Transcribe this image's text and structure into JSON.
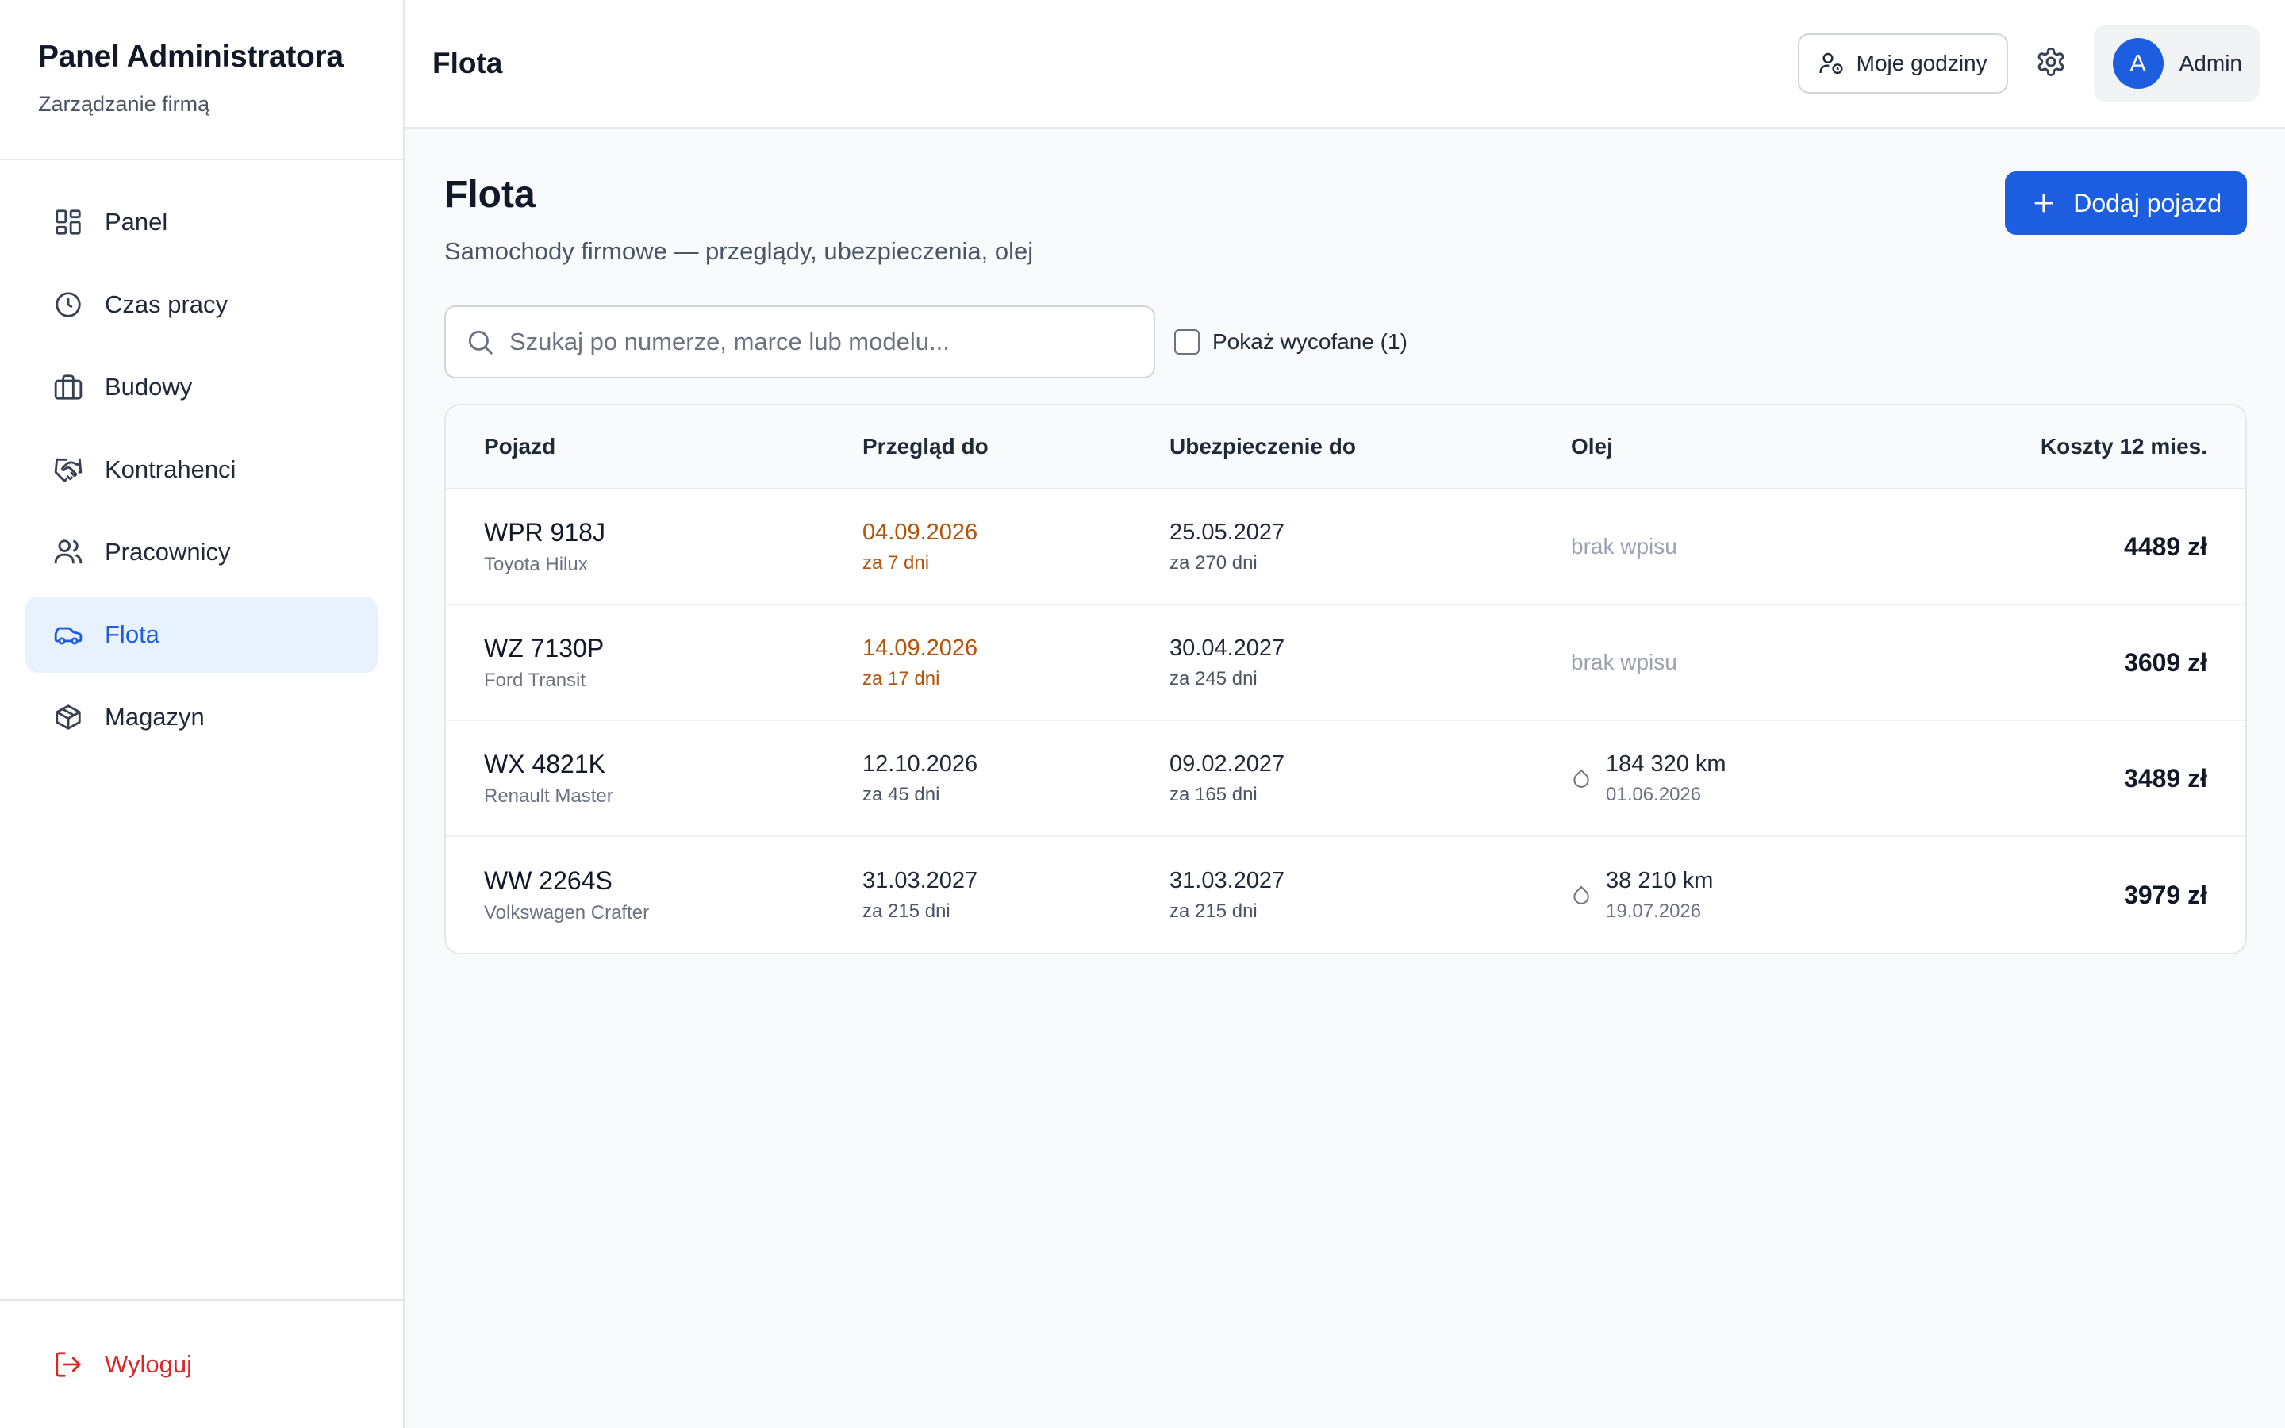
{
  "sidebar": {
    "title": "Panel Administratora",
    "subtitle": "Zarządzanie firmą",
    "items": [
      {
        "label": "Panel",
        "icon": "dashboard-icon"
      },
      {
        "label": "Czas pracy",
        "icon": "clock-icon"
      },
      {
        "label": "Budowy",
        "icon": "briefcase-icon"
      },
      {
        "label": "Kontrahenci",
        "icon": "handshake-icon"
      },
      {
        "label": "Pracownicy",
        "icon": "users-icon"
      },
      {
        "label": "Flota",
        "icon": "car-icon",
        "active": true
      },
      {
        "label": "Magazyn",
        "icon": "package-icon"
      }
    ],
    "logout": "Wyloguj"
  },
  "topbar": {
    "title": "Flota",
    "hours_button": "Moje godziny",
    "user_initial": "A",
    "user_name": "Admin"
  },
  "page": {
    "title": "Flota",
    "subtitle": "Samochody firmowe — przeglądy, ubezpieczenia, olej",
    "add_button": "Dodaj pojazd",
    "search_placeholder": "Szukaj po numerze, marce lub modelu...",
    "show_retired_label": "Pokaż wycofane (1)"
  },
  "table": {
    "headers": [
      "Pojazd",
      "Przegląd do",
      "Ubezpieczenie do",
      "Olej",
      "Koszty 12 mies."
    ],
    "rows": [
      {
        "plate": "WPR 918J",
        "model": "Toyota Hilux",
        "inspection": "04.09.2026",
        "inspection_rel": "za 7 dni",
        "inspection_warn": true,
        "insurance": "25.05.2027",
        "insurance_rel": "za 270 dni",
        "oil_none": "brak wpisu",
        "cost": "4489 zł"
      },
      {
        "plate": "WZ 7130P",
        "model": "Ford Transit",
        "inspection": "14.09.2026",
        "inspection_rel": "za 17 dni",
        "inspection_warn": true,
        "insurance": "30.04.2027",
        "insurance_rel": "za 245 dni",
        "oil_none": "brak wpisu",
        "cost": "3609 zł"
      },
      {
        "plate": "WX 4821K",
        "model": "Renault Master",
        "inspection": "12.10.2026",
        "inspection_rel": "za 45 dni",
        "inspection_warn": false,
        "insurance": "09.02.2027",
        "insurance_rel": "za 165 dni",
        "oil_km": "184 320 km",
        "oil_date": "01.06.2026",
        "cost": "3489 zł"
      },
      {
        "plate": "WW 2264S",
        "model": "Volkswagen Crafter",
        "inspection": "31.03.2027",
        "inspection_rel": "za 215 dni",
        "inspection_warn": false,
        "insurance": "31.03.2027",
        "insurance_rel": "za 215 dni",
        "oil_km": "38 210 km",
        "oil_date": "19.07.2026",
        "cost": "3979 zł"
      }
    ]
  },
  "colors": {
    "accent": "#1d5ee0",
    "active_bg": "#e8f1fe",
    "warning": "#b45309",
    "danger": "#dc2626"
  }
}
